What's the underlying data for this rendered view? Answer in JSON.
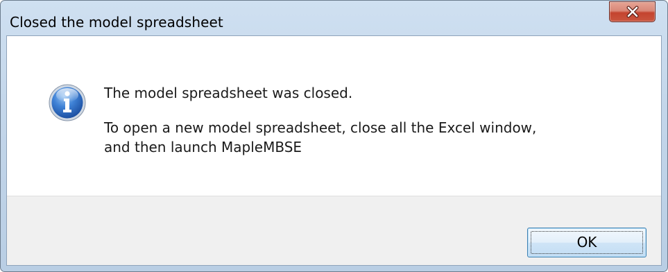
{
  "dialog": {
    "title": "Closed the model spreadsheet",
    "close_icon": "close-x-icon",
    "icon": "information-icon",
    "message_main": "The model spreadsheet was closed.",
    "message_detail_line1": "To open a new model spreadsheet, close all the Excel window,",
    "message_detail_line2": "and then launch MapleMBSE",
    "ok_label": "OK"
  },
  "colors": {
    "titlebar": "#c3d6ea",
    "close_button": "#c4432e",
    "footer": "#f0f0f0",
    "ok_border": "#3c7fb1",
    "icon_blue": "#2d6bc4"
  }
}
